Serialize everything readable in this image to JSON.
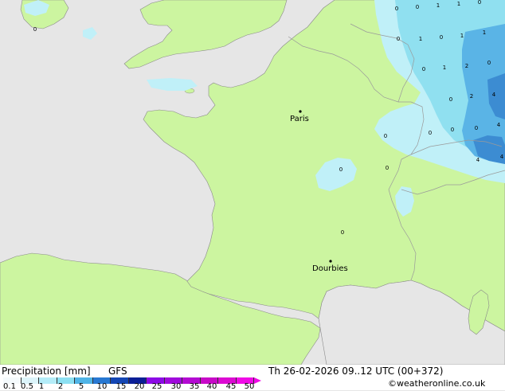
{
  "map": {
    "cities": [
      {
        "name": "Paris"
      },
      {
        "name": "Dourbies"
      }
    ],
    "values": [
      "0",
      "0",
      "0",
      "1",
      "1",
      "0",
      "0",
      "1",
      "0",
      "1",
      "1",
      "0",
      "1",
      "2",
      "0",
      "2",
      "4",
      "0",
      "0",
      "4",
      "0",
      "0",
      "4",
      "4",
      "0",
      "0",
      "0"
    ],
    "colors": {
      "sea": "#e6e6e6",
      "land": "#ccf5a0",
      "precip_light": "#c0f0f8",
      "precip_mid": "#90e0f0",
      "precip_heavy": "#5ab4e6",
      "precip_strong": "#3c8cd2",
      "border": "#9a9a9a"
    }
  },
  "footer": {
    "title": "Precipitation [mm]",
    "model": "GFS",
    "datetime": "Th 26-02-2026 09..12 UTC (00+372)",
    "credit": "©weatheronline.co.uk",
    "scale_labels": [
      "0.1",
      "0.5",
      "1",
      "2",
      "5",
      "10",
      "15",
      "20",
      "25",
      "30",
      "35",
      "40",
      "45",
      "50"
    ],
    "scale_colors": [
      "#f5fafc",
      "#dcf4fa",
      "#b4ecf8",
      "#8ce0f2",
      "#50b4e6",
      "#2878d2",
      "#1446b4",
      "#0a1e96",
      "#8c0ae6",
      "#a00adc",
      "#b40ad2",
      "#c80ac8",
      "#dc0ad2",
      "#f00ae6"
    ]
  }
}
